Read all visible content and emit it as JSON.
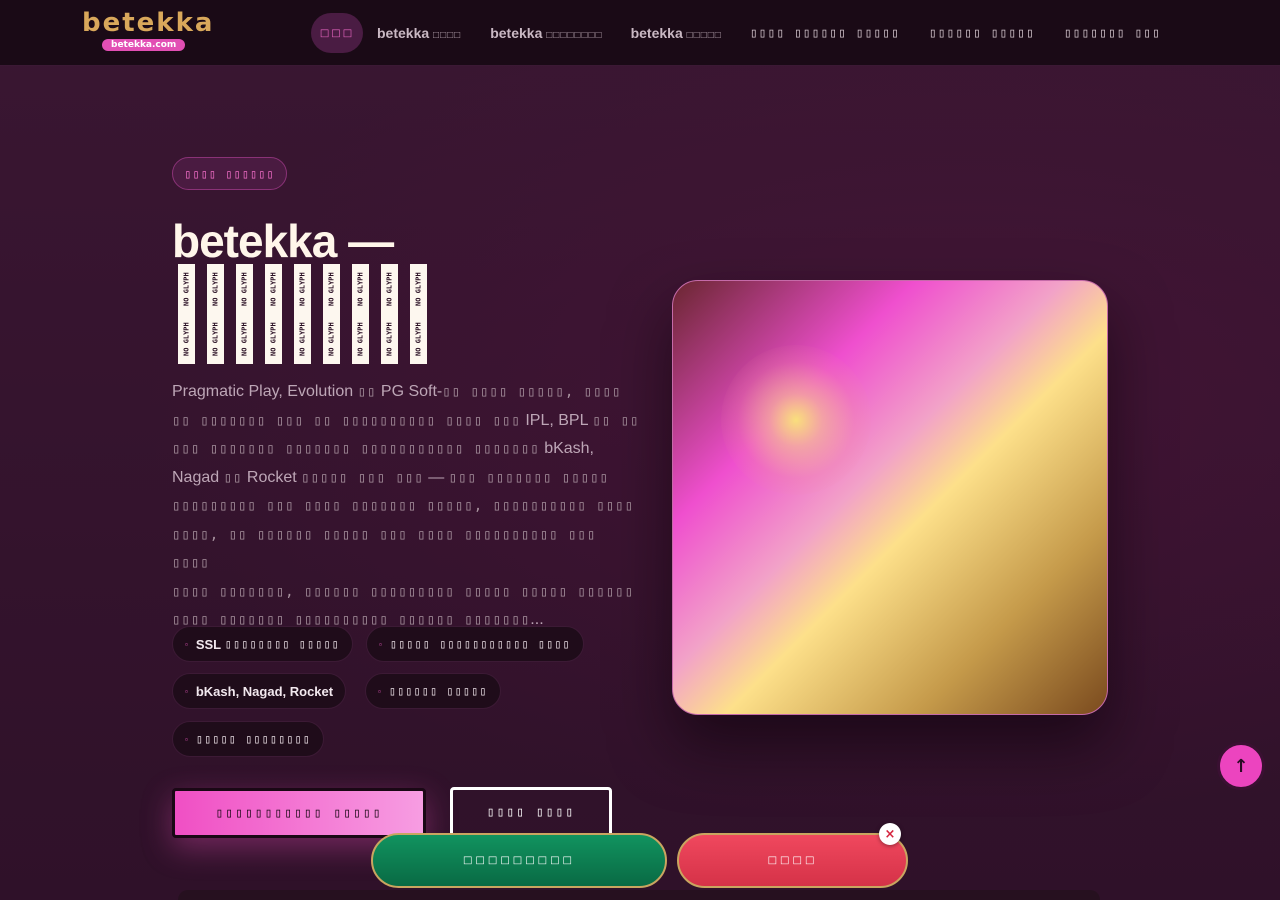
{
  "header": {
    "logo_text": "betekka",
    "logo_badge": "betekka.com",
    "nav": {
      "home_label": "□□□",
      "items": [
        {
          "brand": "betekka",
          "suffix": "□□□□"
        },
        {
          "brand": "betekka",
          "suffix": "□□□□□□□□"
        },
        {
          "brand": "betekka",
          "suffix": "□□□□□"
        },
        {
          "label": "▯▯▯▯ ▯▯▯▯▯▯ ▯▯▯▯▯"
        },
        {
          "label": "▯▯▯▯▯▯ ▯▯▯▯▯"
        },
        {
          "label": "▯▯▯▯▯▯▯ ▯▯▯"
        }
      ]
    }
  },
  "hero": {
    "badge": "▯▯▯▯ ▯▯▯▯▯▯",
    "title": "betekka —",
    "glyph_label": "NO GLYPH",
    "description": {
      "line1_a": "Pragmatic Play, Evolution",
      "line1_b": "▯▯",
      "line1_c": "PG Soft-",
      "line1_d": "▯▯ ▯▯▯▯ ▯▯▯▯▯, ▯▯▯▯",
      "line2_a": "▯▯ ▯▯▯▯▯▯▯ ▯▯▯ ▯▯ ▯▯▯▯▯▯▯▯▯▯ ▯▯▯▯ ▯▯▯",
      "line2_b": "IPL, BPL",
      "line2_c": "▯▯ ▯▯",
      "line3_a": "▯▯▯ ▯▯▯▯▯▯▯ ▯▯▯▯▯▯▯ ▯▯▯▯▯▯▯▯▯▯▯ ▯▯▯▯▯▯▯",
      "line3_b": "bKash,",
      "line4_a": "Nagad",
      "line4_b": "▯▯",
      "line4_c": "Rocket",
      "line4_d": "▯▯▯▯▯ ▯▯▯ ▯▯▯",
      "line4_e": "—",
      "line4_f": "▯▯▯ ▯▯▯▯▯▯▯ ▯▯▯▯▯",
      "line5": "▯▯▯▯▯▯▯▯▯ ▯▯▯ ▯▯▯▯ ▯▯▯▯▯▯▯ ▯▯▯▯▯, ▯▯▯▯▯▯▯▯▯▯ ▯▯▯▯",
      "line6": "▯▯▯▯, ▯▯ ▯▯▯▯▯▯ ▯▯▯▯▯ ▯▯▯ ▯▯▯▯ ▯▯▯▯▯▯▯▯▯▯ ▯▯▯ ▯▯▯▯",
      "line7": "▯▯▯▯ ▯▯▯▯▯▯▯, ▯▯▯▯▯▯ ▯▯▯▯▯▯▯▯▯ ▯▯▯▯▯ ▯▯▯▯▯ ▯▯▯▯▯▯",
      "line8_a": "▯▯▯▯ ▯▯▯▯▯▯▯ ▯▯▯▯▯▯▯▯▯▯ ▯▯▯▯▯▯ ▯▯▯▯▯▯▯",
      "line8_b": "..."
    },
    "chips": [
      {
        "bold": "SSL",
        "glyph": "▯▯▯▯▯▯▯▯ ▯▯▯▯▯"
      },
      {
        "bold": "",
        "glyph": "▯▯▯▯▯ ▯▯▯▯▯▯▯▯▯▯▯ ▯▯▯▯"
      },
      {
        "bold": "bKash, Nagad, Rocket",
        "glyph": ""
      },
      {
        "bold": "",
        "glyph": "▯▯▯▯▯▯ ▯▯▯▯▯"
      },
      {
        "bold": "",
        "glyph": "▯▯▯▯▯ ▯▯▯▯▯▯▯▯"
      }
    ],
    "chip_dot": "▫",
    "primary_button": "▯▯▯▯▯▯▯▯▯▯▯ ▯▯▯▯▯",
    "secondary_button": "▯▯▯▯ ▯▯▯▯"
  },
  "cta_bar": {
    "green_label": "□□□□□□□□□",
    "red_label": "□□□□",
    "close_label": "×"
  },
  "to_top_label": "↑",
  "colors": {
    "background": "#33142d",
    "accent_pink": "#ef4fc4",
    "logo_gold": "#d9a85b",
    "cta_green": "#0f8a59",
    "cta_red": "#e63d54"
  }
}
